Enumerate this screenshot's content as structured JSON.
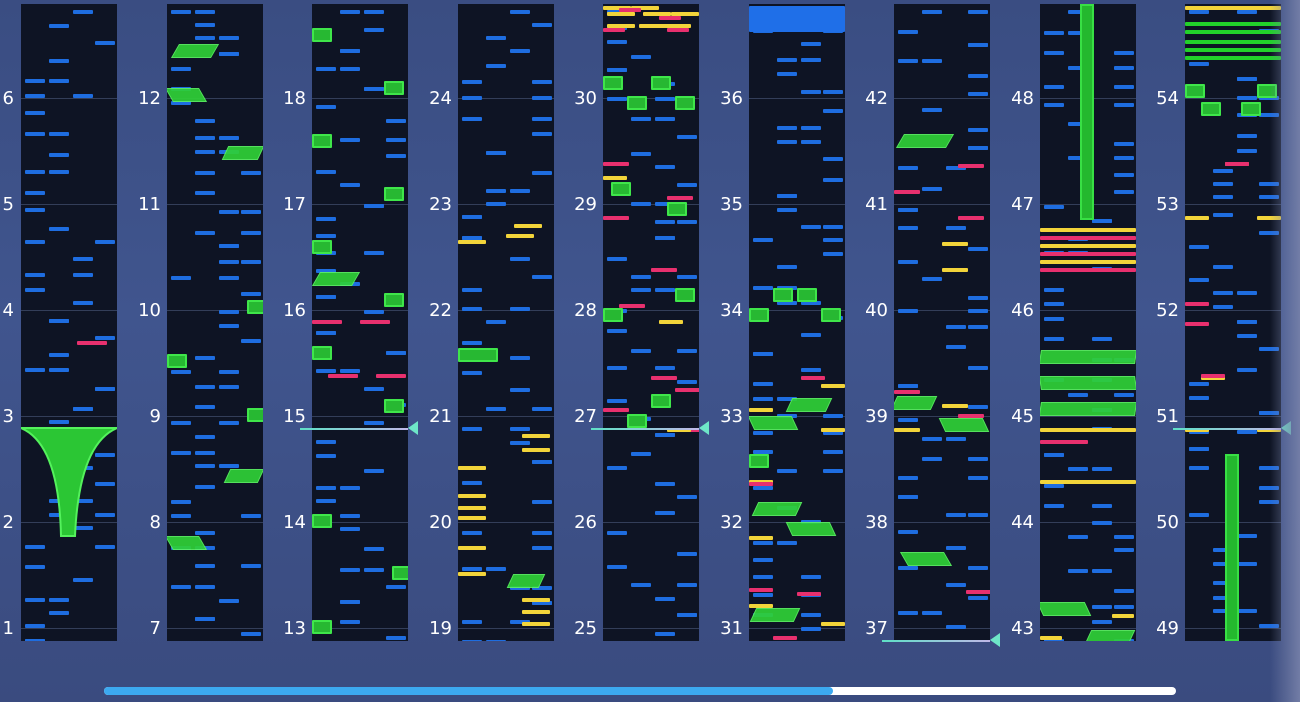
{
  "chart": {
    "columns": [
      {
        "bars": [
          "1",
          "2",
          "3",
          "4",
          "5",
          "6"
        ]
      },
      {
        "bars": [
          "7",
          "8",
          "9",
          "10",
          "11",
          "12"
        ]
      },
      {
        "bars": [
          "13",
          "14",
          "15",
          "16",
          "17",
          "18"
        ]
      },
      {
        "bars": [
          "19",
          "20",
          "21",
          "22",
          "23",
          "24"
        ]
      },
      {
        "bars": [
          "25",
          "26",
          "27",
          "28",
          "29",
          "30"
        ]
      },
      {
        "bars": [
          "31",
          "32",
          "33",
          "34",
          "35",
          "36"
        ]
      },
      {
        "bars": [
          "37",
          "38",
          "39",
          "40",
          "41",
          "42"
        ]
      },
      {
        "bars": [
          "43",
          "44",
          "45",
          "46",
          "47",
          "48"
        ]
      },
      {
        "bars": [
          "49",
          "50",
          "51",
          "52",
          "53",
          "54"
        ]
      }
    ],
    "current_bar": "51"
  },
  "playback": {
    "progress": 0.68
  },
  "colors": {
    "tap": "#1e6de0",
    "drag": "#f2d43a",
    "flick": "#e8306e",
    "hold": "#27b832",
    "lane_background": "#0e1424",
    "progress_fill": "#3ca9f0",
    "progress_track": "#ffffff"
  },
  "icons": {
    "playhead": "playhead-arrow-icon"
  }
}
